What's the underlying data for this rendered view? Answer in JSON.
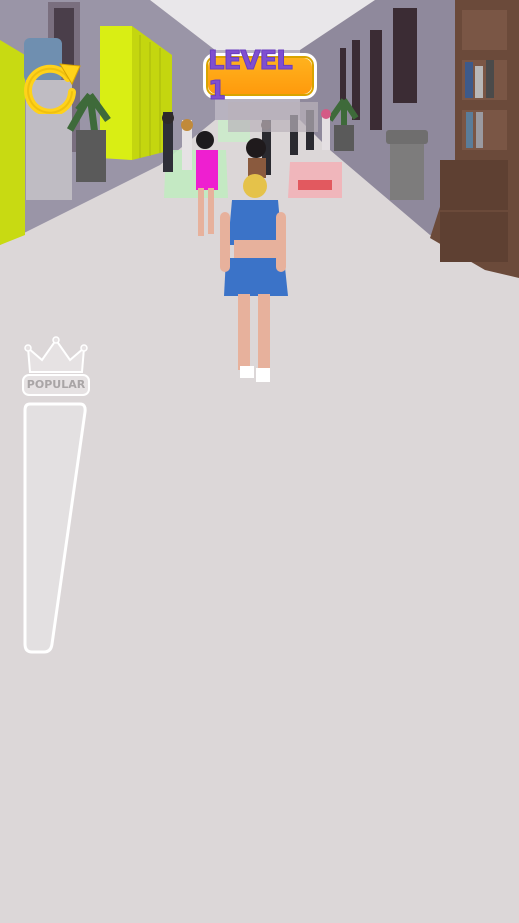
{
  "hud": {
    "restart_icon": "restart-icon",
    "level_label": "LEVEL 1",
    "popular_label": "POPULAR",
    "crown_icon": "crown-icon",
    "popularity_level": 0
  },
  "colors": {
    "floor": "#dcd7d8",
    "wall": "#938e9f",
    "lockers": "#d8ec16",
    "badge_orange": "#ff9f14",
    "badge_text": "#7f4fd0",
    "player_outfit": "#3b73c8"
  }
}
